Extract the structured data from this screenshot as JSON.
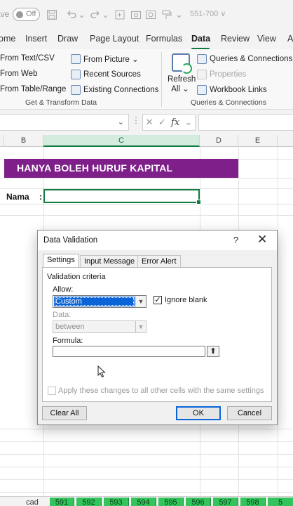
{
  "titlebar": {
    "autosave_label": "ave",
    "toggle_state": "Off",
    "filename": "551-700 ∨"
  },
  "tabs": [
    {
      "label": "ome",
      "active": false
    },
    {
      "label": "Insert",
      "active": false
    },
    {
      "label": "Draw",
      "active": false
    },
    {
      "label": "Page Layout",
      "active": false
    },
    {
      "label": "Formulas",
      "active": false
    },
    {
      "label": "Data",
      "active": true
    },
    {
      "label": "Review",
      "active": false
    },
    {
      "label": "View",
      "active": false
    },
    {
      "label": "A",
      "active": false
    }
  ],
  "ribbon": {
    "get_transform": {
      "from_text_csv": "From Text/CSV",
      "from_web": "From Web",
      "from_table_range": "From Table/Range",
      "from_picture": "From Picture ⌄",
      "recent_sources": "Recent Sources",
      "existing_connections": "Existing Connections",
      "group_label": "Get & Transform Data"
    },
    "queries": {
      "refresh_all": "Refresh All ⌄",
      "queries_connections": "Queries & Connections",
      "properties": "Properties",
      "workbook_links": "Workbook Links",
      "group_label": "Queries & Connections"
    }
  },
  "formula_bar": {
    "name_box": "",
    "fx": "fx",
    "formula": ""
  },
  "columns": [
    {
      "label": "B",
      "selected": false
    },
    {
      "label": "C",
      "selected": true
    },
    {
      "label": "D",
      "selected": false
    },
    {
      "label": "E",
      "selected": false
    }
  ],
  "sheet": {
    "banner": "HANYA BOLEH HURUF KAPITAL",
    "nama_label": "Nama",
    "colon": ":"
  },
  "dialog": {
    "title": "Data Validation",
    "help": "?",
    "close": "✕",
    "tabs": [
      "Settings",
      "Input Message",
      "Error Alert"
    ],
    "active_tab": "Settings",
    "section_title": "Validation criteria",
    "allow_label": "Allow:",
    "allow_value": "Custom",
    "ignore_blank_label": "Ignore blank",
    "ignore_blank_checked": true,
    "data_label": "Data:",
    "data_value": "between",
    "formula_label": "Formula:",
    "formula_value": "",
    "apply_all_label": "Apply these changes to all other cells with the same settings",
    "apply_all_checked": false,
    "clear_all": "Clear All",
    "ok": "OK",
    "cancel": "Cancel"
  },
  "sheet_tabs": [
    "cad",
    "591",
    "592",
    "593",
    "594",
    "595",
    "596",
    "597",
    "598",
    "5"
  ]
}
